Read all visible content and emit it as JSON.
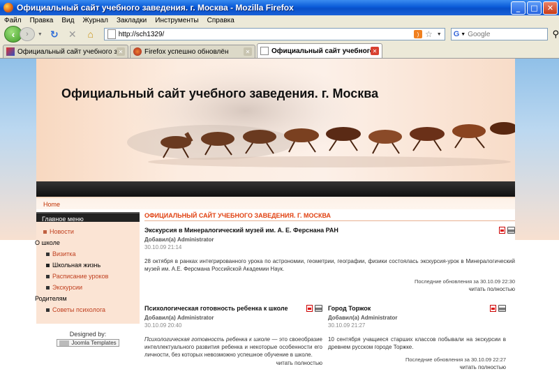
{
  "window": {
    "title": "Официальный сайт учебного заведения. г. Москва - Mozilla Firefox",
    "minimize": "_",
    "maximize": "□",
    "close": "✕"
  },
  "menubar": [
    "Файл",
    "Правка",
    "Вид",
    "Журнал",
    "Закладки",
    "Инструменты",
    "Справка"
  ],
  "navbar": {
    "back_glyph": "‹",
    "forward_glyph": "›",
    "url": "http://sch1329/",
    "search_placeholder": "Google",
    "search_engine_glyph": "G"
  },
  "tabs": [
    {
      "label": "Официальный сайт учебного заведе...",
      "icon": "joomla-icon",
      "active": false
    },
    {
      "label": "Firefox успешно обновлён",
      "icon": "firefox-icon",
      "active": false
    },
    {
      "label": "Официальный сайт учебного заве...",
      "icon": "page-icon",
      "active": true
    }
  ],
  "page": {
    "site_title": "Официальный сайт учебного заведения. г. Москва",
    "breadcrumb": "Home",
    "menu": {
      "heading": "Главное меню",
      "items": [
        {
          "label": "Новости",
          "level": "lvl1"
        },
        {
          "label": "О школе",
          "level": "plain"
        },
        {
          "label": "Визитка",
          "level": "lvl2"
        },
        {
          "label": "Школьная жизнь",
          "level": "lvl2 blk"
        },
        {
          "label": "Расписание уроков",
          "level": "lvl2"
        },
        {
          "label": "Экскурсии",
          "level": "lvl2"
        },
        {
          "label": "Родителям",
          "level": "plain"
        },
        {
          "label": "Советы психолога",
          "level": "lvl2"
        }
      ]
    },
    "designed_by": "Designed by:",
    "joomla_badge": "Joomla Templates",
    "section_title": "ОФИЦИАЛЬНЫЙ САЙТ УЧЕБНОГО ЗАВЕДЕНИЯ. Г. МОСКВА",
    "articles": {
      "lead": {
        "title": "Экскурсия в Минералогический музей им. А. Е. Ферснана РАН",
        "author": "Добавил(а) Administrator",
        "date": "30.10.09 21:14",
        "text": "28 октября в ранках интегрированного урока по астрономии, геометрии, географии, физики состоялась экскурсия-урок в Минералогический музей им. А.Е. Ферсмана Российской Академии Наук.",
        "updated": "Последние обновления за 30.10.09 22:30",
        "more": "читать полностью"
      },
      "left": {
        "title": "Психологическая готовность ребенка к школе",
        "author": "Добавил(а) Administrator",
        "date": "30.10.09 20:40",
        "text_em": "Психологическая готовность ребенка к школе",
        "text": " — это своеобразие интеллектуального развития ребенка и некоторые особенности его личности, без которых невозможно успешное обучение в школе.",
        "more": "читать полностью"
      },
      "right": {
        "title": "Город Торжок",
        "author": "Добавил(а) Administrator",
        "date": "30.10.09 21:27",
        "text": "10 сентября учащиеся старших классов побывали на экскурсии в древнем русском городе Торжке.",
        "updated": "Последние обновления за 30.10.09 22:27",
        "more": "читать полностью"
      }
    }
  },
  "colors": {
    "accent": "#e04010",
    "menu_link": "#c04020",
    "title_bar": "#0a5bd8"
  }
}
